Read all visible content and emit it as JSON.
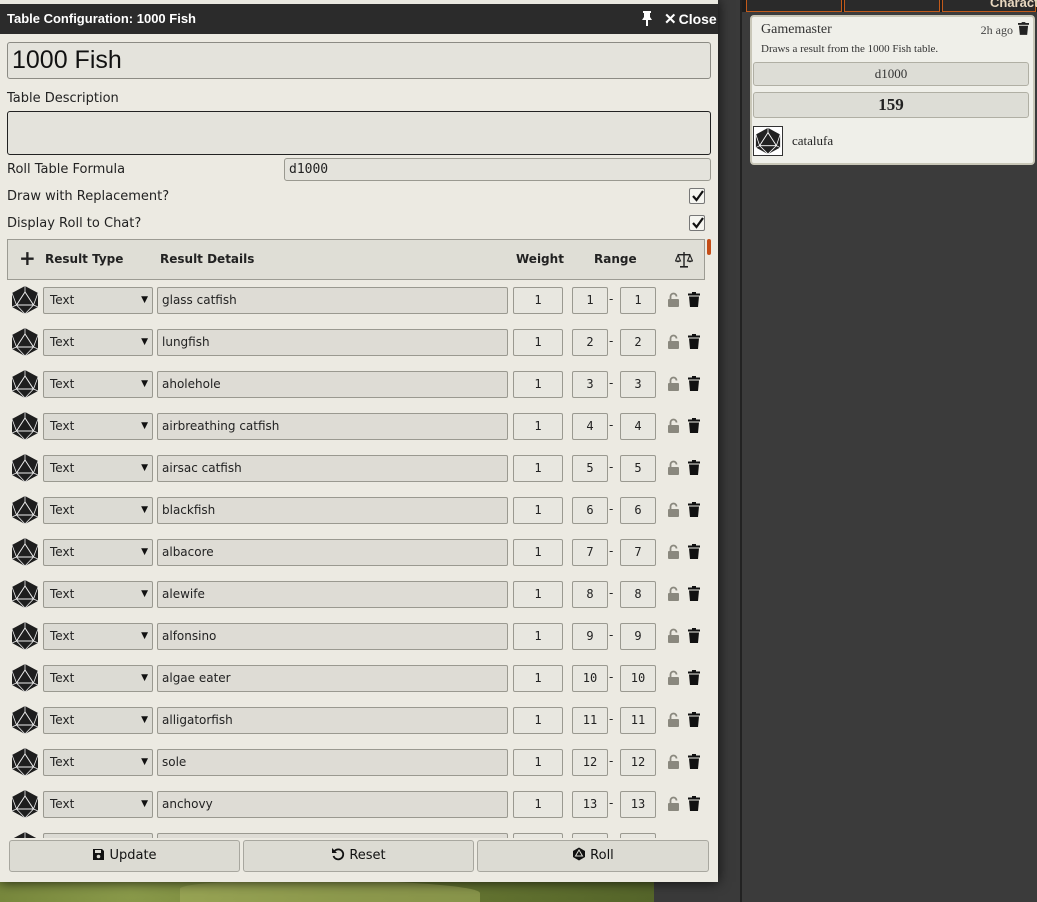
{
  "window": {
    "title": "Table Configuration: 1000 Fish",
    "close_label": "Close"
  },
  "form": {
    "name": "1000 Fish",
    "description_label": "Table Description",
    "description": "",
    "formula_label": "Roll Table Formula",
    "formula": "d1000",
    "replacement_label": "Draw with Replacement?",
    "replacement_checked": true,
    "display_roll_label": "Display Roll to Chat?",
    "display_roll_checked": true
  },
  "table": {
    "headers": {
      "add": "+",
      "type": "Result Type",
      "details": "Result Details",
      "weight": "Weight",
      "range": "Range"
    },
    "rows": [
      {
        "type": "Text",
        "detail": "glass catfish",
        "weight": "1",
        "from": "1",
        "to": "1"
      },
      {
        "type": "Text",
        "detail": "lungfish",
        "weight": "1",
        "from": "2",
        "to": "2"
      },
      {
        "type": "Text",
        "detail": "aholehole",
        "weight": "1",
        "from": "3",
        "to": "3"
      },
      {
        "type": "Text",
        "detail": "airbreathing catfish",
        "weight": "1",
        "from": "4",
        "to": "4"
      },
      {
        "type": "Text",
        "detail": "airsac catfish",
        "weight": "1",
        "from": "5",
        "to": "5"
      },
      {
        "type": "Text",
        "detail": "blackfish",
        "weight": "1",
        "from": "6",
        "to": "6"
      },
      {
        "type": "Text",
        "detail": "albacore",
        "weight": "1",
        "from": "7",
        "to": "7"
      },
      {
        "type": "Text",
        "detail": "alewife",
        "weight": "1",
        "from": "8",
        "to": "8"
      },
      {
        "type": "Text",
        "detail": "alfonsino",
        "weight": "1",
        "from": "9",
        "to": "9"
      },
      {
        "type": "Text",
        "detail": "algae eater",
        "weight": "1",
        "from": "10",
        "to": "10"
      },
      {
        "type": "Text",
        "detail": "alligatorfish",
        "weight": "1",
        "from": "11",
        "to": "11"
      },
      {
        "type": "Text",
        "detail": "sole",
        "weight": "1",
        "from": "12",
        "to": "12"
      },
      {
        "type": "Text",
        "detail": "anchovy",
        "weight": "1",
        "from": "13",
        "to": "13"
      },
      {
        "type": "Text",
        "detail": "",
        "weight": "",
        "from": "",
        "to": ""
      }
    ]
  },
  "footer": {
    "update_label": "Update",
    "reset_label": "Reset",
    "roll_label": "Roll"
  },
  "sidebar": {
    "tab_label": "Character",
    "chat": {
      "speaker": "Gamemaster",
      "time": "2h ago",
      "flavor": "Draws a result from the 1000 Fish table.",
      "formula": "d1000",
      "total": "159",
      "result": "catalufa"
    }
  },
  "colors": {
    "accent": "#c44d17",
    "titlebar": "#2b2b2b",
    "panel": "#eceae2"
  },
  "icons": [
    "thumbtack-icon",
    "close-icon",
    "plus-icon",
    "balance-scale-icon",
    "d20-icon",
    "unlock-icon",
    "trash-icon",
    "save-icon",
    "undo-icon",
    "dice-icon"
  ]
}
